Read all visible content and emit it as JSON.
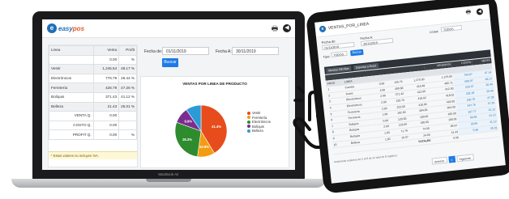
{
  "laptop": {
    "model_label": "MacBook Air",
    "logo": {
      "prefix": "easy",
      "suffix": "pos",
      "badge": "e"
    },
    "table": {
      "headers": [
        "Linea",
        "Venta",
        "Profit"
      ],
      "rows": [
        {
          "label": "",
          "venta": "",
          "profit": "0.00",
          "pct": "%"
        },
        {
          "label": "Vestir",
          "venta": "1,245.54",
          "profit": "48.17 %",
          "pct": ""
        },
        {
          "label": "Electrónicos",
          "venta": "776.79",
          "profit": "26.44 %",
          "pct": ""
        },
        {
          "label": "Ferretería",
          "venta": "426.79",
          "profit": "47.26 %",
          "pct": ""
        },
        {
          "label": "Bolíquis",
          "venta": "371.43",
          "profit": "41.12 %",
          "pct": ""
        },
        {
          "label": "Belleza",
          "venta": "21.43",
          "profit": "25.01 %",
          "pct": ""
        }
      ],
      "summary": [
        {
          "label": "VENTA Q.",
          "value": "0.00"
        },
        {
          "label": "COSTO Q.",
          "value": "0.00"
        },
        {
          "label": "PROFIT Q.",
          "value": "0.00",
          "pct": "%"
        }
      ],
      "footnote": "* Estos valores no incluyen IVA."
    },
    "filters": {
      "from_label": "Fecha de:",
      "from_value": "01/11/2019",
      "to_label": "Fecha A:",
      "to_value": "30/11/2019",
      "search_button": "Buscar"
    },
    "chart_data": {
      "type": "pie",
      "title": "VENTAS POR LINEA DE PRODUCTO",
      "categories": [
        "Vestir",
        "Ferretería",
        "Electrónicos",
        "Bolíquis",
        "Belleza"
      ],
      "values": [
        41.4,
        10.8,
        28.3,
        9.9,
        9.6
      ],
      "value_labels": [
        "41.4%",
        "10.8%",
        "28.3%",
        "9.9%",
        ""
      ],
      "colors": [
        "#e74c1c",
        "#f39c12",
        "#2e8b2e",
        "#7b2c8f",
        "#2b9bd6"
      ],
      "legend_position": "right"
    }
  },
  "tablet": {
    "title": "VENTAS_POR_LINEA",
    "from_label": "Fecha de:",
    "from_value": "01/11/2019",
    "to_label": "Fecha A:",
    "to_value": "30/11/2019",
    "linea_label": "Línea:",
    "linea_value": "TODOS",
    "tipo_label": "Tipo:",
    "tipo_value": "TODOS",
    "search_button": "Buscar",
    "show_filter": "Mostrar 150 filas",
    "export_button": "Exportar a Excel",
    "col_header": "VENDIDOS",
    "col_header2": "COSTO",
    "col_header3": "VENTA",
    "sub_headers": [
      "PROD",
      "LINEA"
    ],
    "rows": [
      [
        "1",
        "Camisa",
        "0.00",
        "126.79",
        "1,275.00",
        "1,275.00",
        "764.87",
        "47.14"
      ],
      [
        "2",
        "Jeans",
        "4.00",
        "409.88",
        "419.48",
        "485.71",
        "600.07",
        "48.17"
      ],
      [
        "3",
        "Electrónicos",
        "2.00",
        "271.42",
        "412.00",
        "412.00",
        "226.37",
        "26.44"
      ],
      [
        "4",
        "Electrónicos",
        "2.00",
        "229.76",
        "418.02",
        "418.02",
        "182.19",
        "26.44"
      ],
      [
        "5",
        "Ferretería",
        "2.00",
        "223.00",
        "418.00",
        "418.00",
        "180.79",
        "47.26"
      ],
      [
        "6",
        "Ferretería",
        "1.00",
        "192.00",
        "304.00",
        "304.00",
        "247.75",
        "47.26"
      ],
      [
        "7",
        "Bolíquis",
        "0.00",
        "120.00",
        "180.00",
        "180.00",
        "107.77",
        "41.12"
      ],
      [
        "8",
        "Bolíquis",
        "2.00",
        "133.00",
        "180.00",
        "180.00",
        "59.65",
        "41.12"
      ],
      [
        "9",
        "Bolíquis",
        "1.00",
        "71.79",
        "74.00",
        "86.97",
        "29.56",
        "41.12"
      ],
      [
        "10",
        "Belleza",
        "1.00",
        "16.07",
        "24.00",
        "21.43",
        "5.36",
        "25.01"
      ]
    ],
    "totals_label": "TOTALES",
    "totals_value": "0.00",
    "footer_text": "Mostrando registros del 1 al 8 de un total de 8 registros",
    "pagination": {
      "prev": "Anterior",
      "page": "1",
      "next": "Siguiente"
    }
  }
}
